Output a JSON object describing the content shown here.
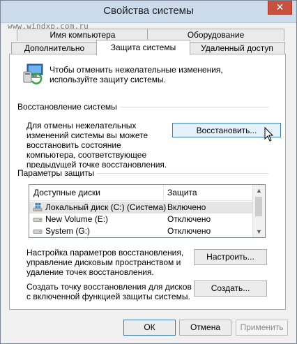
{
  "window": {
    "title": "Свойства системы",
    "close_glyph": "✕"
  },
  "watermark": "www.windxp.com.ru",
  "tabs": {
    "back_row": [
      "Имя компьютера",
      "Оборудование"
    ],
    "front_row": [
      "Дополнительно",
      "Защита системы",
      "Удаленный доступ"
    ],
    "active": "Защита системы"
  },
  "intro_text": "Чтобы отменить нежелательные изменения, используйте защиту системы.",
  "restore": {
    "section_title": "Восстановление системы",
    "description": "Для отмены нежелательных изменений системы вы можете восстановить состояние компьютера, соответствующее предыдущей точке восстановления.",
    "button_label": "Восстановить..."
  },
  "protection": {
    "section_title": "Параметры защиты",
    "columns": [
      "Доступные диски",
      "Защита"
    ],
    "disks": [
      {
        "name": "Локальный диск (C:) (Система)",
        "status": "Включено",
        "icon": "system-drive-icon"
      },
      {
        "name": "New Volume (E:)",
        "status": "Отключено",
        "icon": "drive-icon"
      },
      {
        "name": "System (G:)",
        "status": "Отключено",
        "icon": "drive-icon"
      }
    ],
    "configure_text": "Настройка параметров восстановления, управление дисковым пространством и удаление точек восстановления.",
    "configure_button": "Настроить...",
    "create_text": "Создать точку восстановления для дисков с включенной функцией защиты системы.",
    "create_button": "Создать..."
  },
  "footer": {
    "ok": "ОК",
    "cancel": "Отмена",
    "apply": "Применить"
  },
  "colors": {
    "titlebar": "#ccdbec",
    "close": "#c7503f",
    "focus_border": "#3c7fb1",
    "windows_blue": "#1e88d8"
  }
}
